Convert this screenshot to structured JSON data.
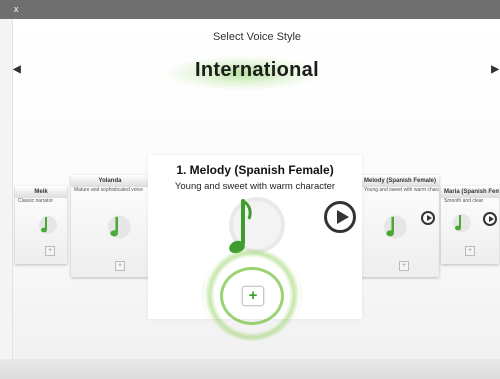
{
  "window": {
    "corner_glyph": "x"
  },
  "header": {
    "label": "Select Voice Style",
    "category": "International"
  },
  "nav": {
    "prev_glyph": "◀",
    "next_glyph": "▶"
  },
  "selected_voice": {
    "title": "1. Melody (Spanish Female)",
    "description": "Young and sweet with warm character"
  },
  "side_cards": [
    {
      "title": "Meik",
      "sub": "Classic narrator"
    },
    {
      "title": "Yolanda",
      "sub": "Mature and sophisticated voice"
    },
    {
      "title": "Melody (Spanish Female)",
      "sub": "Young and sweet with warm character"
    },
    {
      "title": "Maria (Spanish Female)",
      "sub": "Smooth and clear"
    }
  ],
  "colors": {
    "accent_green": "#3e9d2d",
    "play_stroke": "#333333",
    "topbar": "#6f6f6f"
  },
  "icons": {
    "note": "music-note-icon",
    "play": "play-icon",
    "add": "plus-icon"
  }
}
